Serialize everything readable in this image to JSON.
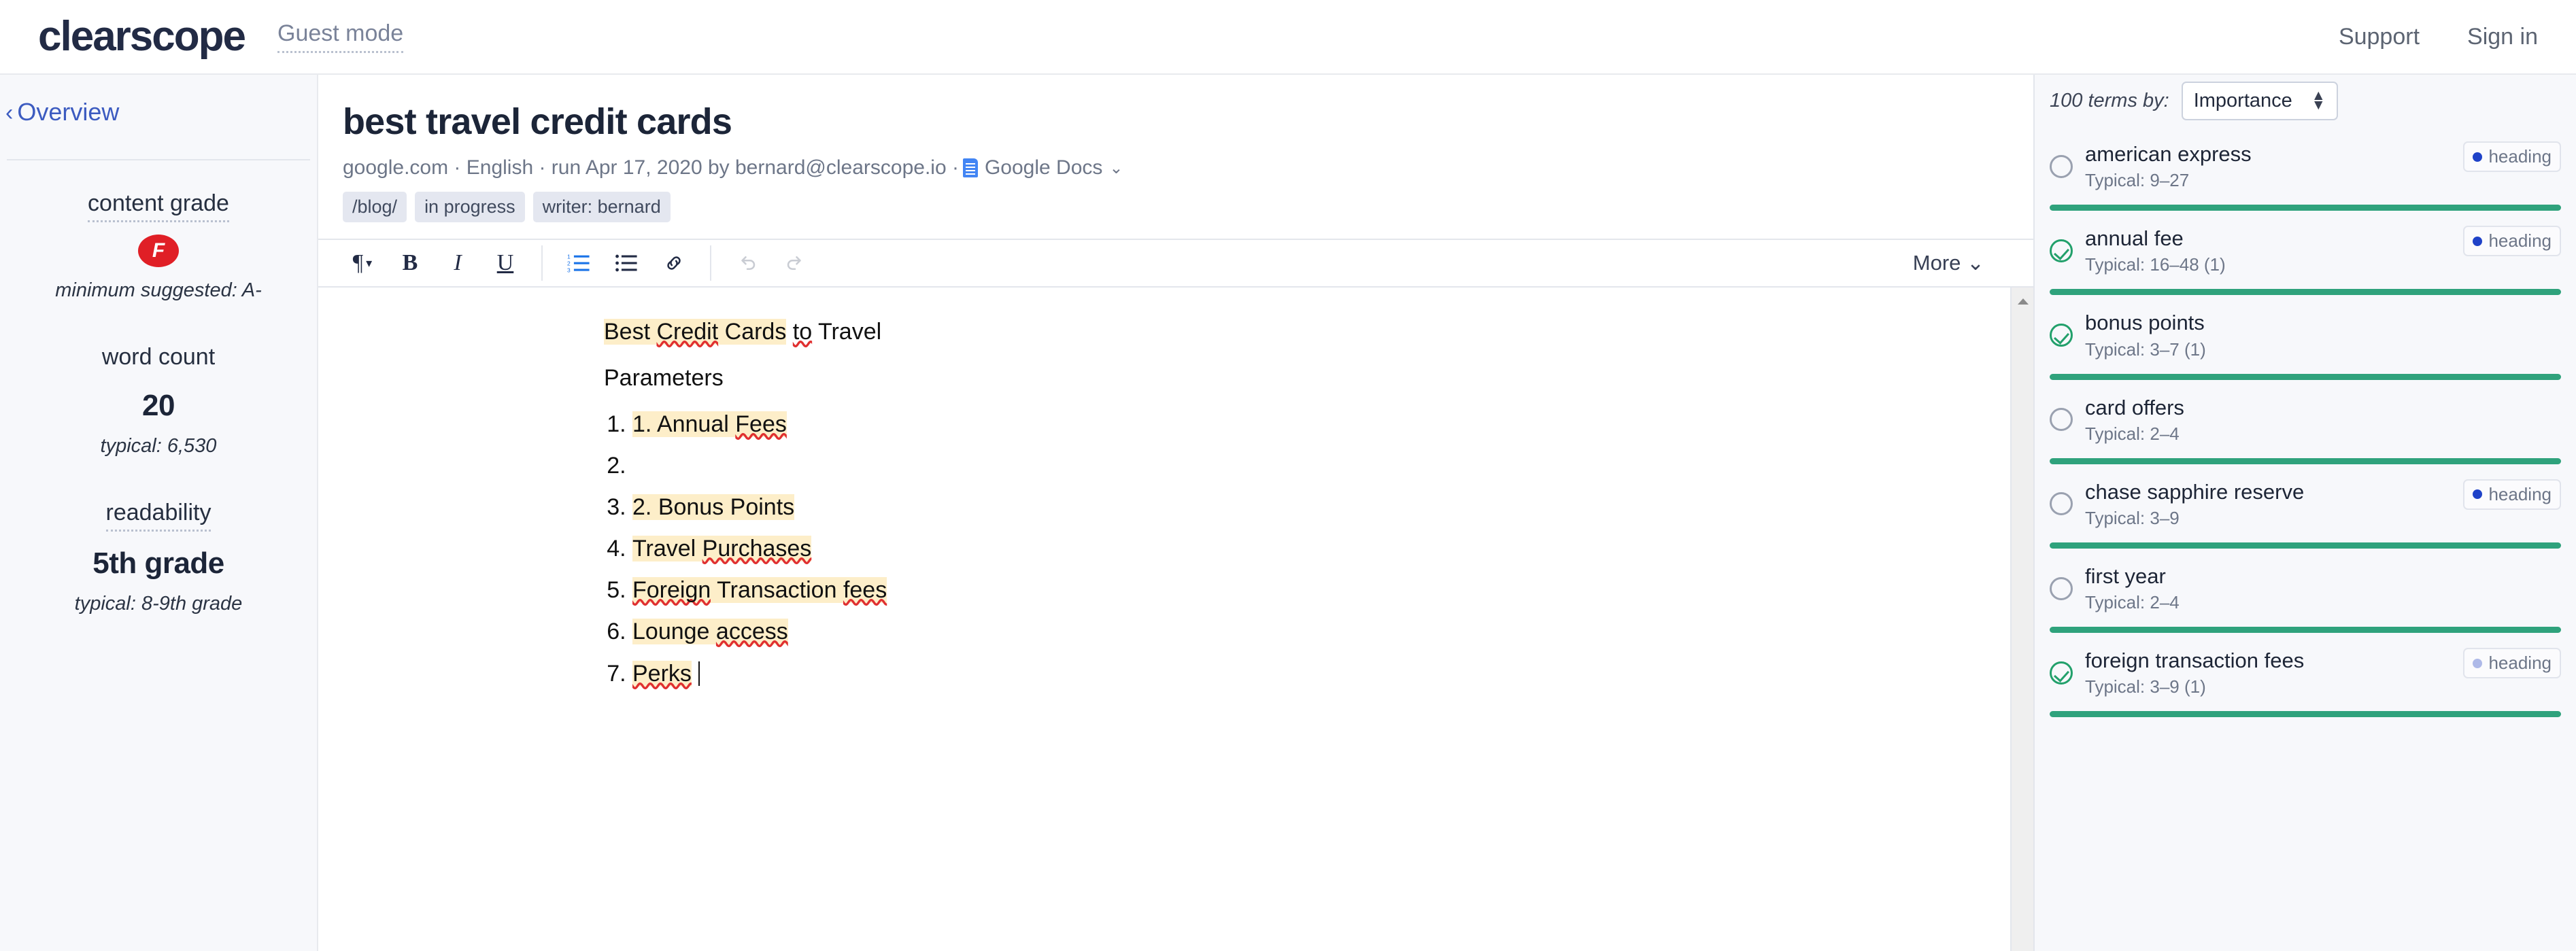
{
  "topnav": {
    "logo": "clearscope",
    "guest_mode": "Guest mode",
    "support": "Support",
    "signin": "Sign in"
  },
  "sidebar": {
    "back_label": "Overview",
    "back_chevron": "chevron-left-icon",
    "content_grade": {
      "label": "content grade",
      "grade": "F",
      "grade_color": "#e01f26",
      "sub": "minimum suggested: A-"
    },
    "word_count": {
      "label": "word count",
      "value": "20",
      "sub": "typical: 6,530"
    },
    "readability": {
      "label": "readability",
      "value": "5th grade",
      "sub": "typical: 8-9th grade"
    }
  },
  "document": {
    "title": "best travel credit cards",
    "meta_prefix": "google.com · English · run Apr 17, 2020 by bernard@clearscope.io · ",
    "gdocs_label": "Google Docs",
    "gdocs_caret": "chevron-down-icon",
    "tags": [
      "/blog/",
      "in progress",
      "writer: bernard"
    ]
  },
  "toolbar": {
    "paragraph": "¶",
    "paragraph_caret": "▾",
    "bold": "B",
    "italic": "I",
    "underline": "U",
    "ordered_list": "ordered-list-icon",
    "bullet_list": "bullet-list-icon",
    "link": "link-icon",
    "undo": "undo-icon",
    "redo": "redo-icon",
    "more_label": "More",
    "more_caret": "⌄"
  },
  "editor": {
    "heading_parts": [
      {
        "text": "Best ",
        "highlight": true,
        "spell": false
      },
      {
        "text": "Credit",
        "highlight": true,
        "spell": true
      },
      {
        "text": " Cards",
        "highlight": true,
        "spell": false
      },
      {
        "text": " ",
        "highlight": false,
        "spell": false
      },
      {
        "text": "to",
        "highlight": false,
        "spell": true
      },
      {
        "text": " Travel",
        "highlight": false,
        "spell": false
      }
    ],
    "paragraph": "Parameters",
    "list_items": [
      [
        {
          "text": "1. ",
          "highlight": true,
          "spell": false
        },
        {
          "text": "Annual ",
          "highlight": true,
          "spell": false
        },
        {
          "text": "Fees",
          "highlight": true,
          "spell": true
        }
      ],
      [],
      [
        {
          "text": "2. ",
          "highlight": true,
          "spell": false
        },
        {
          "text": "Bonus Points",
          "highlight": true,
          "spell": false
        }
      ],
      [
        {
          "text": " Travel ",
          "highlight": true,
          "spell": false
        },
        {
          "text": "Purchases",
          "highlight": true,
          "spell": true
        }
      ],
      [
        {
          "text": "Foreign",
          "highlight": true,
          "spell": true
        },
        {
          "text": " Transaction ",
          "highlight": true,
          "spell": false
        },
        {
          "text": "fees",
          "highlight": true,
          "spell": true
        }
      ],
      [
        {
          "text": "Lounge ",
          "highlight": true,
          "spell": false
        },
        {
          "text": "access",
          "highlight": true,
          "spell": true
        }
      ],
      [
        {
          "text": "Perks",
          "highlight": true,
          "spell": true
        }
      ]
    ]
  },
  "terms_panel": {
    "count_label": "100 terms by:",
    "sort_value": "Importance",
    "sort_caret": "updown-caret-icon",
    "terms": [
      {
        "name": "american express",
        "typical": "Typical: 9–27",
        "done": false,
        "badge": "heading",
        "badge_light": false
      },
      {
        "name": "annual fee",
        "typical": "Typical: 16–48 (1)",
        "done": true,
        "badge": "heading",
        "badge_light": false
      },
      {
        "name": "bonus points",
        "typical": "Typical: 3–7 (1)",
        "done": true,
        "badge": null,
        "badge_light": false
      },
      {
        "name": "card offers",
        "typical": "Typical: 2–4",
        "done": false,
        "badge": null,
        "badge_light": false
      },
      {
        "name": "chase sapphire reserve",
        "typical": "Typical: 3–9",
        "done": false,
        "badge": "heading",
        "badge_light": false
      },
      {
        "name": "first year",
        "typical": "Typical: 2–4",
        "done": false,
        "badge": null,
        "badge_light": false
      },
      {
        "name": "foreign transaction fees",
        "typical": "Typical: 3–9 (1)",
        "done": true,
        "badge": "heading",
        "badge_light": true
      }
    ]
  }
}
